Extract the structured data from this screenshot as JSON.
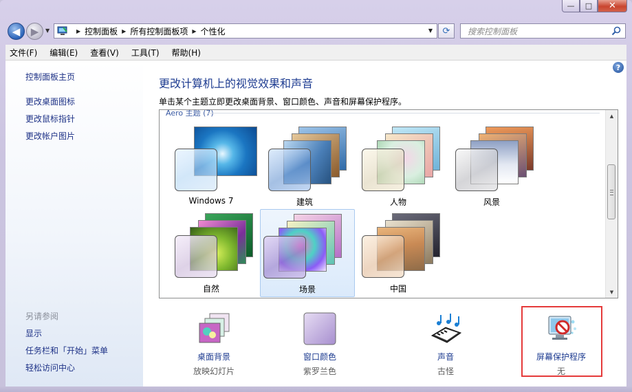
{
  "window": {
    "buttons": {
      "minimize": "—",
      "maximize": "□",
      "close": "✕"
    }
  },
  "nav": {
    "breadcrumbs": [
      "控制面板",
      "所有控制面板项",
      "个性化"
    ],
    "search_placeholder": "搜索控制面板"
  },
  "menu": [
    "文件(F)",
    "编辑(E)",
    "查看(V)",
    "工具(T)",
    "帮助(H)"
  ],
  "sidebar": {
    "links": [
      "控制面板主页",
      "更改桌面图标",
      "更改鼠标指针",
      "更改帐户图片"
    ],
    "see_also_heading": "另请参阅",
    "see_also": [
      "显示",
      "任务栏和「开始」菜单",
      "轻松访问中心"
    ]
  },
  "main": {
    "title": "更改计算机上的视觉效果和声音",
    "subtitle": "单击某个主题立即更改桌面背景、窗口颜色、声音和屏幕保护程序。",
    "group_label": "Aero 主题 (7)",
    "themes": [
      {
        "name": "Windows 7",
        "selected": false
      },
      {
        "name": "建筑",
        "selected": false
      },
      {
        "name": "人物",
        "selected": false
      },
      {
        "name": "风景",
        "selected": false
      },
      {
        "name": "自然",
        "selected": false
      },
      {
        "name": "场景",
        "selected": true
      },
      {
        "name": "中国",
        "selected": false
      }
    ]
  },
  "settings": [
    {
      "label": "桌面背景",
      "value": "放映幻灯片"
    },
    {
      "label": "窗口颜色",
      "value": "紫罗兰色"
    },
    {
      "label": "声音",
      "value": "古怪"
    },
    {
      "label": "屏幕保护程序",
      "value": "无"
    }
  ],
  "colors": {
    "link": "#1e3c91",
    "highlight_border": "#e53a3a",
    "selection": "#dbeafb"
  }
}
